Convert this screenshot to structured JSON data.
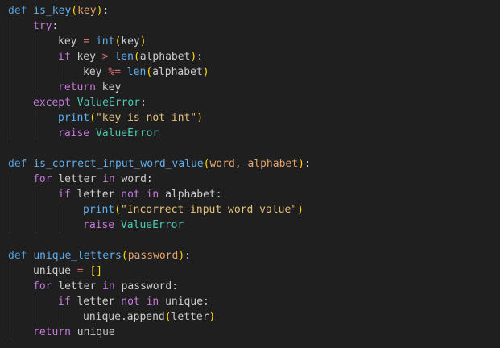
{
  "theme": {
    "background": "#1f1f1f",
    "text": "#cccccc",
    "keyword_def": "#569cd6",
    "keyword_flow": "#c678dd",
    "function": "#61afef",
    "parameter": "#e5a36b",
    "operator": "#e06c75",
    "string": "#e5c07b",
    "class": "#4ec9b0",
    "bracket_1": "#ffd700",
    "bracket_2": "#da70d6"
  },
  "lines": [
    {
      "indent": 0,
      "tokens": [
        [
          "def",
          "tok-def"
        ],
        [
          " ",
          ""
        ],
        [
          "is_key",
          "tok-fn"
        ],
        [
          "(",
          "tok-br1"
        ],
        [
          "key",
          "tok-param"
        ],
        [
          ")",
          "tok-br1"
        ],
        [
          ":",
          "tok-pn"
        ]
      ]
    },
    {
      "indent": 1,
      "tokens": [
        [
          "try",
          "tok-kw2"
        ],
        [
          ":",
          "tok-pn"
        ]
      ]
    },
    {
      "indent": 2,
      "tokens": [
        [
          "key",
          "tok-var"
        ],
        [
          " ",
          ""
        ],
        [
          "=",
          "tok-op"
        ],
        [
          " ",
          ""
        ],
        [
          "int",
          "tok-bi"
        ],
        [
          "(",
          "tok-br1"
        ],
        [
          "key",
          "tok-var"
        ],
        [
          ")",
          "tok-br1"
        ]
      ]
    },
    {
      "indent": 2,
      "tokens": [
        [
          "if",
          "tok-kw2"
        ],
        [
          " key ",
          ""
        ],
        [
          ">",
          "tok-op"
        ],
        [
          " ",
          ""
        ],
        [
          "len",
          "tok-bi"
        ],
        [
          "(",
          "tok-br1"
        ],
        [
          "alphabet",
          "tok-var"
        ],
        [
          ")",
          "tok-br1"
        ],
        [
          ":",
          "tok-pn"
        ]
      ]
    },
    {
      "indent": 3,
      "tokens": [
        [
          "key ",
          ""
        ],
        [
          "%=",
          "tok-op"
        ],
        [
          " ",
          ""
        ],
        [
          "len",
          "tok-bi"
        ],
        [
          "(",
          "tok-br1"
        ],
        [
          "alphabet",
          "tok-var"
        ],
        [
          ")",
          "tok-br1"
        ]
      ]
    },
    {
      "indent": 2,
      "tokens": [
        [
          "return",
          "tok-kw2"
        ],
        [
          " key",
          ""
        ]
      ]
    },
    {
      "indent": 1,
      "tokens": [
        [
          "except",
          "tok-kw2"
        ],
        [
          " ",
          ""
        ],
        [
          "ValueError",
          "tok-cls"
        ],
        [
          ":",
          "tok-pn"
        ]
      ]
    },
    {
      "indent": 2,
      "tokens": [
        [
          "print",
          "tok-bi"
        ],
        [
          "(",
          "tok-br1"
        ],
        [
          "\"key is not int\"",
          "tok-str"
        ],
        [
          ")",
          "tok-br1"
        ]
      ]
    },
    {
      "indent": 2,
      "tokens": [
        [
          "raise",
          "tok-kw2"
        ],
        [
          " ",
          ""
        ],
        [
          "ValueError",
          "tok-cls"
        ]
      ]
    },
    {
      "indent": 0,
      "tokens": []
    },
    {
      "indent": 0,
      "tokens": [
        [
          "def",
          "tok-def"
        ],
        [
          " ",
          ""
        ],
        [
          "is_correct_input_word_value",
          "tok-fn"
        ],
        [
          "(",
          "tok-br1"
        ],
        [
          "word",
          "tok-param"
        ],
        [
          ", ",
          ""
        ],
        [
          "alphabet",
          "tok-param"
        ],
        [
          ")",
          "tok-br1"
        ],
        [
          ":",
          "tok-pn"
        ]
      ]
    },
    {
      "indent": 1,
      "tokens": [
        [
          "for",
          "tok-kw2"
        ],
        [
          " letter ",
          ""
        ],
        [
          "in",
          "tok-kw2"
        ],
        [
          " word:",
          ""
        ]
      ]
    },
    {
      "indent": 2,
      "tokens": [
        [
          "if",
          "tok-kw2"
        ],
        [
          " letter ",
          ""
        ],
        [
          "not",
          "tok-kw2"
        ],
        [
          " ",
          ""
        ],
        [
          "in",
          "tok-kw2"
        ],
        [
          " alphabet:",
          ""
        ]
      ]
    },
    {
      "indent": 3,
      "tokens": [
        [
          "print",
          "tok-bi"
        ],
        [
          "(",
          "tok-br1"
        ],
        [
          "\"Incorrect input word value\"",
          "tok-str"
        ],
        [
          ")",
          "tok-br1"
        ]
      ]
    },
    {
      "indent": 3,
      "tokens": [
        [
          "raise",
          "tok-kw2"
        ],
        [
          " ",
          ""
        ],
        [
          "ValueError",
          "tok-cls"
        ]
      ]
    },
    {
      "indent": 0,
      "tokens": []
    },
    {
      "indent": 0,
      "tokens": [
        [
          "def",
          "tok-def"
        ],
        [
          " ",
          ""
        ],
        [
          "unique_letters",
          "tok-fn"
        ],
        [
          "(",
          "tok-br1"
        ],
        [
          "password",
          "tok-param"
        ],
        [
          ")",
          "tok-br1"
        ],
        [
          ":",
          "tok-pn"
        ]
      ]
    },
    {
      "indent": 1,
      "tokens": [
        [
          "unique ",
          ""
        ],
        [
          "=",
          "tok-op"
        ],
        [
          " ",
          ""
        ],
        [
          "[]",
          "tok-br1"
        ]
      ]
    },
    {
      "indent": 1,
      "tokens": [
        [
          "for",
          "tok-kw2"
        ],
        [
          " letter ",
          ""
        ],
        [
          "in",
          "tok-kw2"
        ],
        [
          " password:",
          ""
        ]
      ]
    },
    {
      "indent": 2,
      "tokens": [
        [
          "if",
          "tok-kw2"
        ],
        [
          " letter ",
          ""
        ],
        [
          "not",
          "tok-kw2"
        ],
        [
          " ",
          ""
        ],
        [
          "in",
          "tok-kw2"
        ],
        [
          " unique:",
          ""
        ]
      ]
    },
    {
      "indent": 3,
      "tokens": [
        [
          "unique.append",
          ""
        ],
        [
          "(",
          "tok-br1"
        ],
        [
          "letter",
          "tok-var"
        ],
        [
          ")",
          "tok-br1"
        ]
      ]
    },
    {
      "indent": 1,
      "tokens": [
        [
          "return",
          "tok-kw2"
        ],
        [
          " unique",
          ""
        ]
      ]
    }
  ]
}
